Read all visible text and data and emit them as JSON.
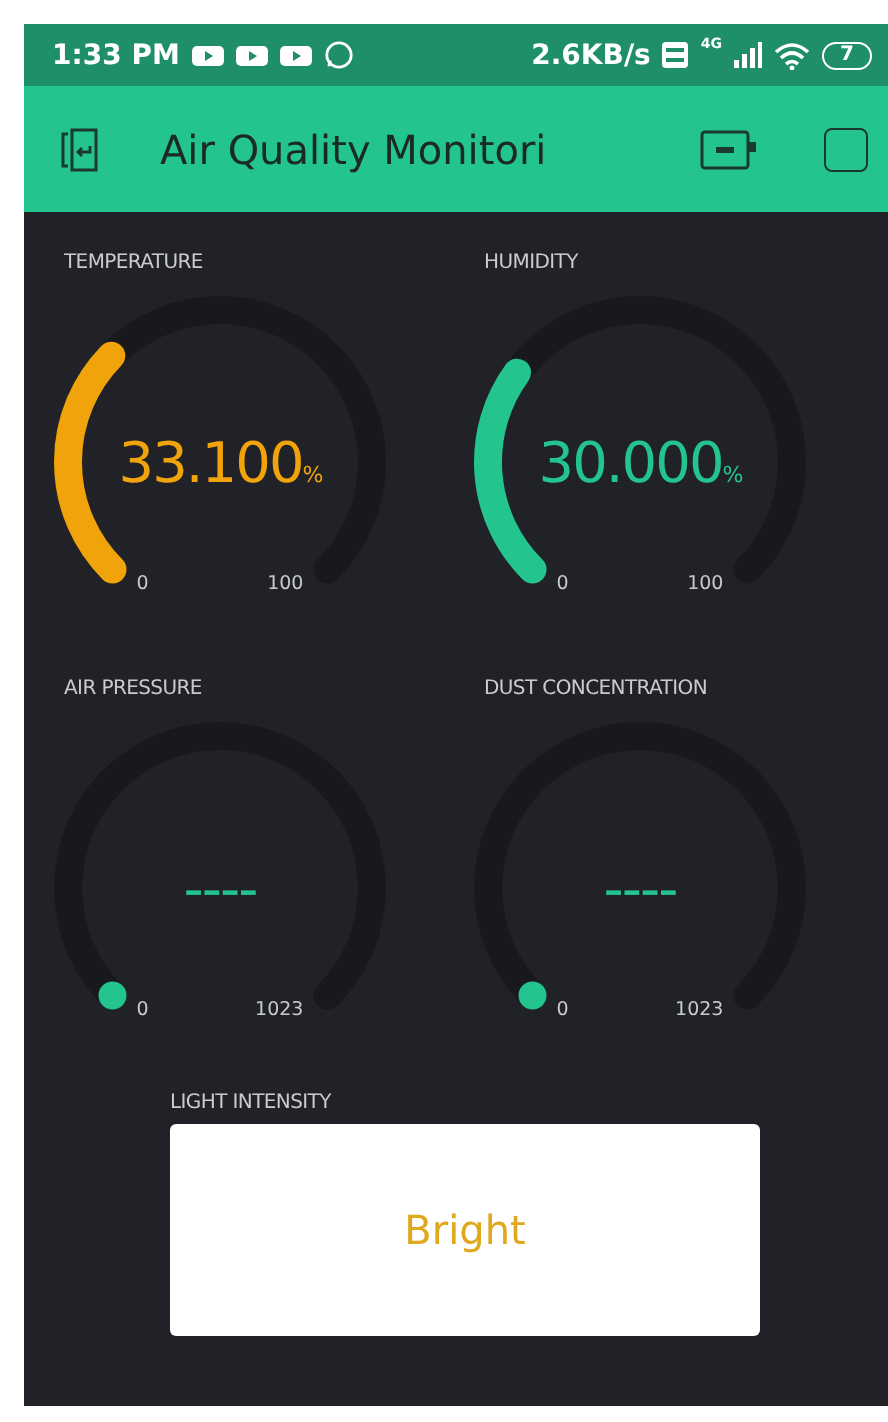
{
  "status_bar": {
    "time": "1:33 PM",
    "speed": "2.6KB/s",
    "network": "4G",
    "battery": "7"
  },
  "header": {
    "title": "Air Quality Monitori"
  },
  "gauges": [
    {
      "label": "TEMPERATURE",
      "value": "33.100",
      "unit": "%",
      "color": "#f0a30a",
      "min": "0",
      "max": "100"
    },
    {
      "label": "HUMIDITY",
      "value": "30.000",
      "unit": "%",
      "color": "#23c48e",
      "min": "0",
      "max": "100"
    },
    {
      "label": "AIR PRESSURE",
      "value": "----",
      "color": "#23c48e",
      "min": "0",
      "max": "1023"
    },
    {
      "label": "DUST CONCENTRATION",
      "value": "----",
      "color": "#23c48e",
      "min": "0",
      "max": "1023"
    }
  ],
  "display": {
    "label": "LIGHT INTENSITY",
    "value": "Bright"
  }
}
